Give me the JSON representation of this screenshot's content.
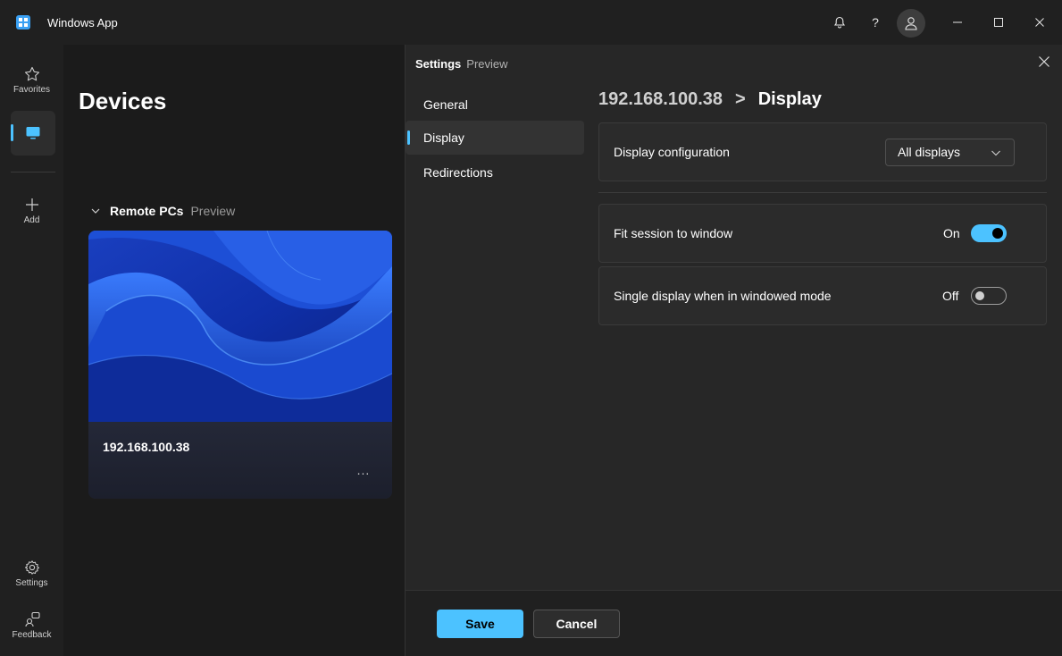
{
  "app": {
    "title": "Windows App"
  },
  "rail": {
    "favorites_label": "Favorites",
    "add_label": "Add",
    "settings_label": "Settings",
    "feedback_label": "Feedback"
  },
  "devices": {
    "title": "Devices",
    "section_title": "Remote PCs",
    "section_tag": "Preview",
    "pc_name": "192.168.100.38",
    "more_label": "..."
  },
  "settings": {
    "title": "Settings",
    "tag": "Preview",
    "nav": [
      {
        "label": "General"
      },
      {
        "label": "Display"
      },
      {
        "label": "Redirections"
      }
    ],
    "breadcrumb": {
      "parent": "192.168.100.38",
      "separator": ">",
      "current": "Display"
    },
    "display_config": {
      "label": "Display configuration",
      "value": "All displays"
    },
    "fit_session": {
      "label": "Fit session to window",
      "state": "On"
    },
    "single_display": {
      "label": "Single display when in windowed mode",
      "state": "Off"
    },
    "save_label": "Save",
    "cancel_label": "Cancel"
  },
  "colors": {
    "accent": "#4cc2ff",
    "background": "#202020",
    "panel": "#272727"
  },
  "icons": {
    "notifications": "bell-icon",
    "help": "help-icon",
    "account": "user-icon"
  }
}
